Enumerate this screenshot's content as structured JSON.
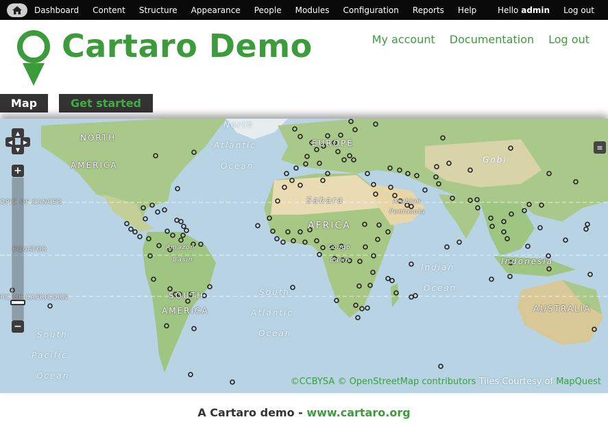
{
  "toolbar": {
    "items": [
      "Dashboard",
      "Content",
      "Structure",
      "Appearance",
      "People",
      "Modules",
      "Configuration",
      "Reports",
      "Help"
    ],
    "hello_prefix": "Hello",
    "username": "admin",
    "logout": "Log out"
  },
  "header": {
    "site_name": "Cartaro Demo",
    "secondary_menu": [
      "My account",
      "Documentation",
      "Log out"
    ]
  },
  "tabs": {
    "map": "Map",
    "get_started": "Get started"
  },
  "map": {
    "labels": {
      "north": "NORTH",
      "america": "AMERICA",
      "europe": "EUROPE",
      "gobi": "Gobi",
      "sahara": "Sahara",
      "arabian": "Arabian",
      "peninsula": "Peninsula",
      "africa": "AFRICA",
      "amazon": "Amazon",
      "amazon_basin": "Basin",
      "congo": "Congo",
      "congo_basin": "Basin",
      "indonesia": "Indonesia",
      "south": "SOUTH",
      "south_america": "AMERICA",
      "australia": "AUSTRALIA",
      "tropic_cancer": "TROPIC OF CANCER",
      "equator": "EQUATOR",
      "tropic_capricorn": "TROPIC OF CAPRICORN",
      "north_atlantic_1": "North",
      "north_atlantic_2": "Atlantic",
      "north_atlantic_3": "Ocean",
      "south_atlantic_1": "South",
      "south_atlantic_2": "Atlantic",
      "south_atlantic_3": "Ocean",
      "indian_1": "Indian",
      "indian_2": "Ocean",
      "south_pacific_1": "South",
      "south_pacific_2": "Pacific",
      "south_pacific_3": "Ocean"
    },
    "controls": {
      "zoom_in": "+",
      "zoom_out": "−"
    },
    "attribution": {
      "ccbysa": "©CCBYSA",
      "osm": "© OpenStreetMap contributors",
      "tiles": "Tiles Courtesy of",
      "mapquest": "MapQuest"
    },
    "colors": {
      "ocean": "#b7d3e4",
      "land_green": "#a9c98a",
      "desert": "#e9dcb4",
      "marker": "#222222"
    }
  },
  "footer": {
    "text": "A Cartaro demo - ",
    "link": "www.cartaro.org"
  }
}
